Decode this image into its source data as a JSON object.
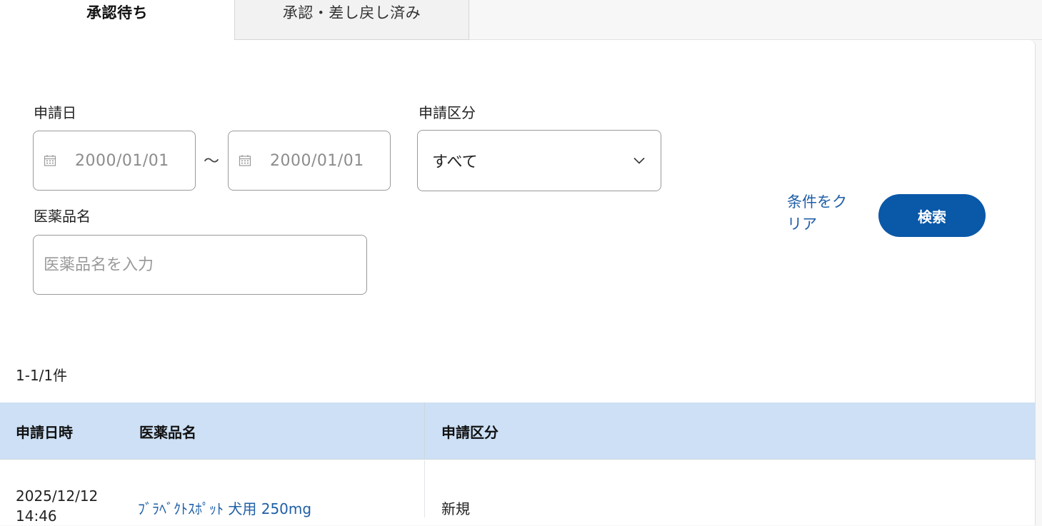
{
  "tabs": {
    "pending": "承認待ち",
    "processed": "承認・差し戻し済み"
  },
  "filters": {
    "date_label": "申請日",
    "date_from": "2000/01/01",
    "date_to": "2000/01/01",
    "date_separator": "～",
    "category_label": "申請区分",
    "category_value": "すべて",
    "drug_label": "医薬品名",
    "drug_placeholder": "医薬品名を入力",
    "clear_label": "条件をクリア",
    "search_label": "検索"
  },
  "results": {
    "count": "1-1/1件",
    "columns": [
      "申請日時",
      "医薬品名",
      "申請区分"
    ],
    "rows": [
      {
        "datetime": "2025/12/12 14:46",
        "drug": "ﾌﾞﾗﾍﾞｸﾄｽﾎﾟｯﾄ 犬用 250mg",
        "category": "新規"
      }
    ]
  },
  "colors": {
    "accent": "#0a58a8",
    "link": "#1f5fa6",
    "table_header_bg": "#cde0f5"
  },
  "icons": [
    "calendar-icon",
    "chevron-down-icon"
  ]
}
